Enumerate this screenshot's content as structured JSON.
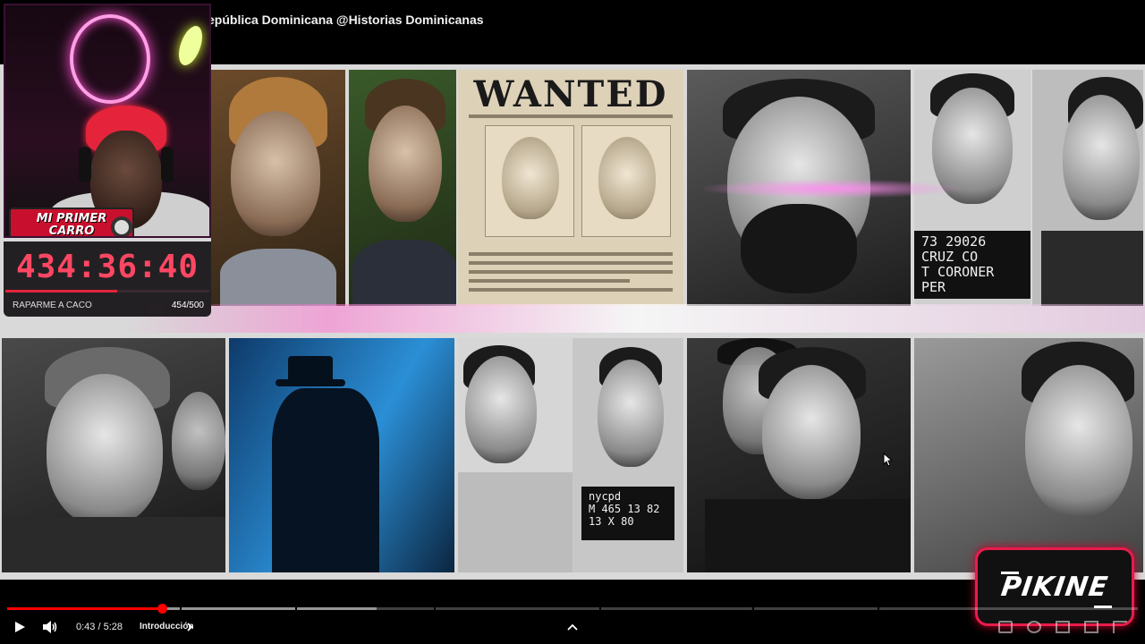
{
  "video": {
    "title": "epública Dominicana @Historias Dominicanas"
  },
  "collage": {
    "wanted": "WANTED",
    "mugshot_top": "73 29026",
    "mugshot_line2": "CRUZ CO",
    "mugshot_line3": "T CORONER",
    "mugshot_line4": "PER",
    "placard_line1": "nycpd",
    "placard_line2": "M 465 13 82",
    "placard_line3": "13 X 80"
  },
  "overlay": {
    "car_badge_line1": "MI PRIMER",
    "car_badge_line2": "CARRO",
    "timer": {
      "value": "434:36:40",
      "label": "RAPARME A CACO",
      "count": "454/500",
      "progress": 0.55
    },
    "brand_logo": "PIKINE"
  },
  "controls": {
    "time": "0:43 / 5:28",
    "chapter": "Introducción",
    "played_fraction": 0.137,
    "buffered_fraction": 0.327,
    "icons": [
      "play-icon",
      "volume-icon",
      "chevron-right-icon",
      "chevron-up-icon"
    ]
  },
  "colors": {
    "progress": "#ff0000",
    "timer": "#ff4763",
    "brand_border": "#e81c4a",
    "neon": "#ff9fe7"
  }
}
